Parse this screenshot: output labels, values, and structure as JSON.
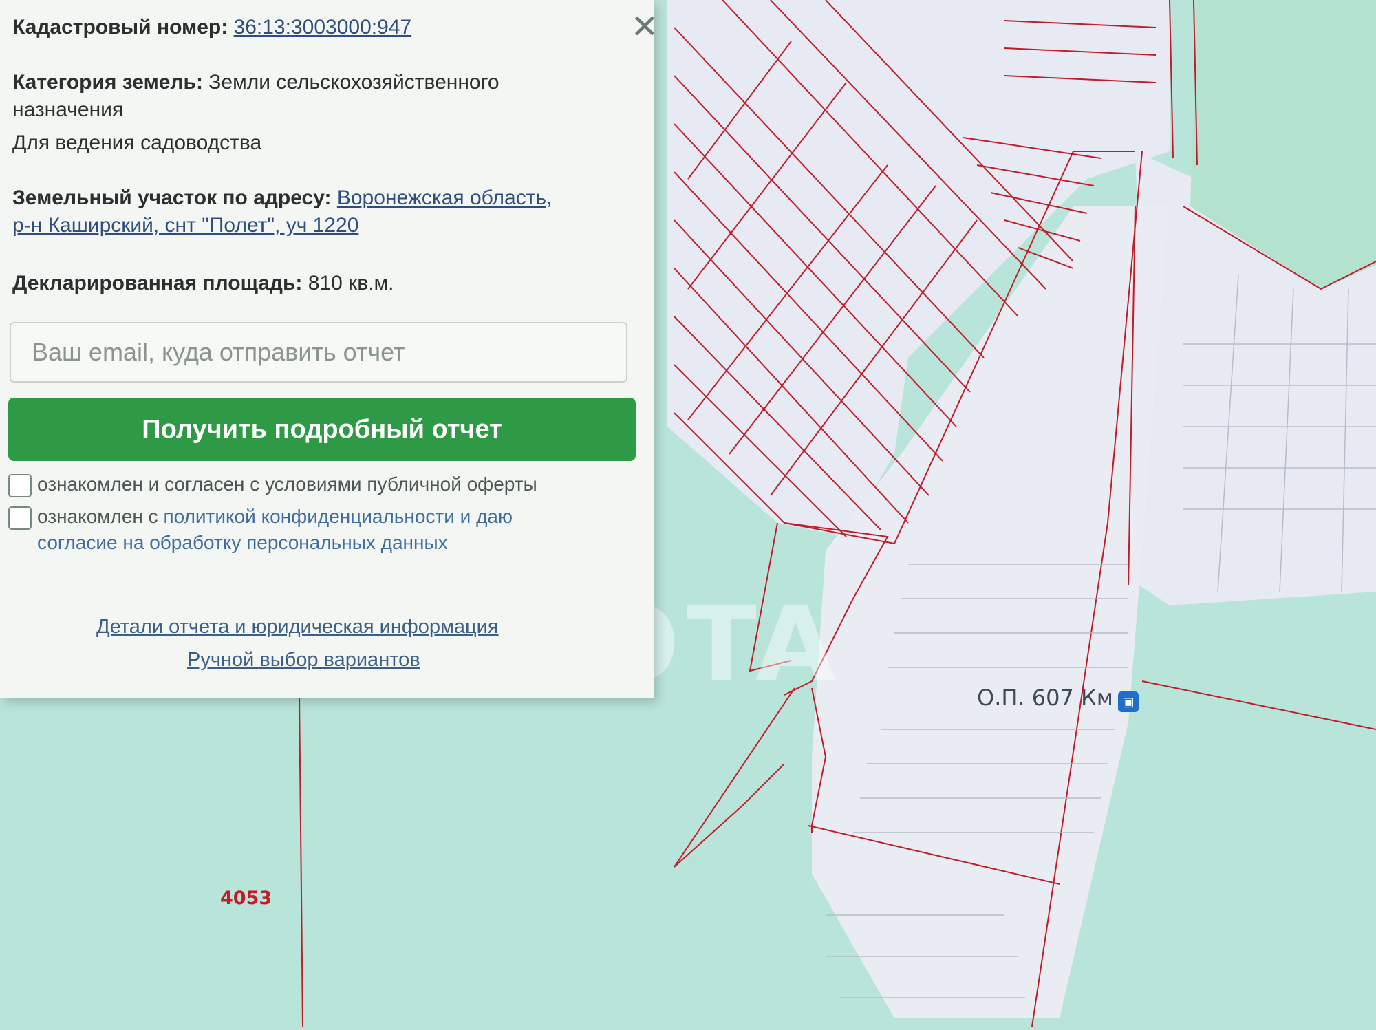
{
  "panel": {
    "cadastral_label": "Кадастровый номер:",
    "cadastral_value": "36:13:3003000:947",
    "category_label": "Категория земель:",
    "category_value_1": "Земли сельскохозяйственного",
    "category_value_2": "назначения",
    "usage": "Для ведения садоводства",
    "address_label": "Земельный участок по адресу:",
    "address_value_1": "Воронежская область,",
    "address_value_2": "р-н Каширский, снт \"Полет\", уч 1220",
    "area_label": "Декларированная площадь:",
    "area_value": "810 кв.м.",
    "email_placeholder": "Ваш email, куда отправить отчет",
    "report_button": "Получить подробный отчет",
    "check1_text": "ознакомлен и согласен с условиями публичной оферты",
    "check2_prefix": "ознакомлен с ",
    "check2_link": "политикой конфиденциальности и даю",
    "check2_cont": "согласие на обработку персональных данных",
    "details_link": "Детали отчета и юридическая информация",
    "manual_link": "Ручной выбор вариантов"
  },
  "map": {
    "parcel_number": "4053",
    "bus_stop": "О.П. 607 Км",
    "stop_icon": "bus-stop-icon",
    "colors": {
      "water": "#b9e4d9",
      "parcel_line": "#c11c2a",
      "built_area": "#e9ecf3"
    }
  }
}
